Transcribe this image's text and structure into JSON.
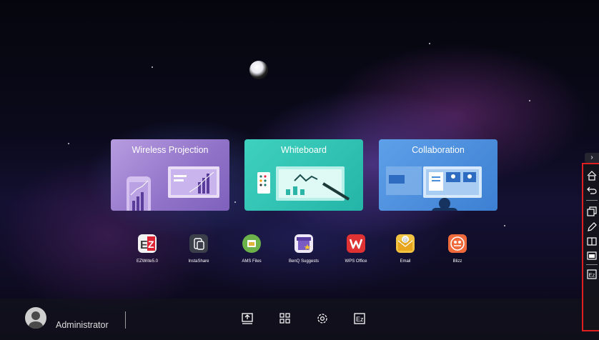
{
  "cards": {
    "wireless_projection": "Wireless Projection",
    "whiteboard": "Whiteboard",
    "collaboration": "Collaboration"
  },
  "apps": [
    {
      "label": "EZWrite5.0",
      "icon": "ezwrite-icon"
    },
    {
      "label": "InstaShare",
      "icon": "instashare-icon"
    },
    {
      "label": "AMS Files",
      "icon": "ams-files-icon"
    },
    {
      "label": "BenQ Suggests",
      "icon": "benq-suggests-icon"
    },
    {
      "label": "WPS Office",
      "icon": "wps-office-icon"
    },
    {
      "label": "Email",
      "icon": "email-icon"
    },
    {
      "label": "Blizz",
      "icon": "blizz-icon"
    }
  ],
  "taskbar": {
    "user": "Administrator",
    "buttons": [
      "input-source-icon",
      "apps-grid-icon",
      "settings-icon",
      "ezwrite-icon"
    ]
  },
  "sidebar": {
    "buttons": [
      "home-icon",
      "back-icon",
      "multitask-icon",
      "annotate-icon",
      "split-screen-icon",
      "screenshot-icon",
      "ezwrite-icon"
    ]
  },
  "colors": {
    "wireless_projection": "#9b7fd0",
    "whiteboard": "#2ec0b0",
    "collaboration": "#4a8ddc",
    "sidebar_highlight": "#e02020"
  }
}
